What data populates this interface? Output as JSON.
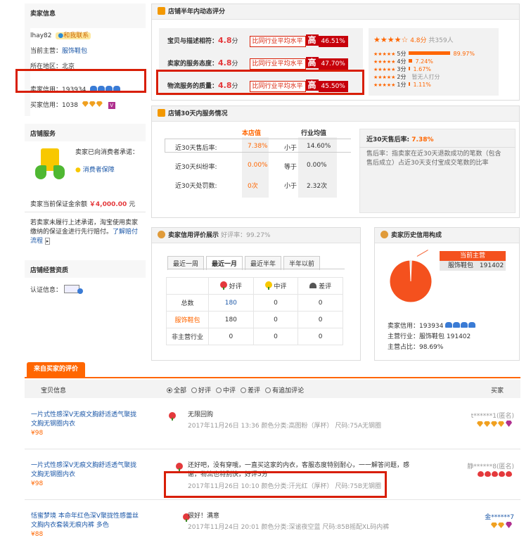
{
  "seller_info": {
    "title": "卖家信息",
    "name": "lhay82",
    "contact": "和我联系",
    "main_biz_label": "当前主营：",
    "main_biz": "服饰鞋包",
    "region_label": "所在地区：",
    "region": "北京",
    "seller_credit_label": "卖家信用：",
    "seller_credit": "193934",
    "buyer_credit_label": "买家信用：",
    "buyer_credit": "1038"
  },
  "shop_service": {
    "title": "店铺服务",
    "promise_text": "卖家已向消费者承诺：",
    "guarantee": "消费者保障",
    "deposit_label": "卖家当前保证金余额",
    "deposit": "￥4,000.00",
    "deposit_unit": "元",
    "note": "若卖家未履行上述承诺，淘宝使用卖家缴纳的保证金进行先行赔付。",
    "note_link": "了解赔付流程"
  },
  "shop_qual": {
    "title": "店铺经营资质",
    "cert_label": "认证信息："
  },
  "dsr": {
    "title": "店铺半年内动态评分",
    "rows": [
      {
        "label": "宝贝与描述相符：",
        "score": "4.8",
        "unit": "分",
        "cmp": "比同行业平均水平",
        "level": "高",
        "pct": "46.51%"
      },
      {
        "label": "卖家的服务态度：",
        "score": "4.8",
        "unit": "分",
        "cmp": "比同行业平均水平",
        "level": "高",
        "pct": "47.70%"
      },
      {
        "label": "物流服务的质量：",
        "score": "4.8",
        "unit": "分",
        "cmp": "比同行业平均水平",
        "level": "高",
        "pct": "45.50%"
      }
    ],
    "summary_score": "4.8分",
    "summary_count": "共359人",
    "dist": [
      {
        "label": "5分",
        "pct": "89.97%",
        "frac": 0.8997
      },
      {
        "label": "4分",
        "pct": "7.24%",
        "frac": 0.0724
      },
      {
        "label": "3分",
        "pct": "1.67%",
        "frac": 0.0167
      },
      {
        "label": "2分",
        "pct": "暂无人打分",
        "frac": 0
      },
      {
        "label": "1分",
        "pct": "1.11%",
        "frac": 0.0111
      }
    ]
  },
  "service30": {
    "title": "店铺30天内服务情况",
    "col_shop": "本店值",
    "col_ind": "行业均值",
    "rows": [
      {
        "label": "近30天售后率:",
        "shop": "7.38%",
        "cmp": "小于",
        "ind": "14.60%"
      },
      {
        "label": "近30天纠纷率:",
        "shop": "0.00%",
        "cmp": "等于",
        "ind": "0.00%"
      },
      {
        "label": "近30天处罚数:",
        "shop": "0次",
        "cmp": "小于",
        "ind": "2.32次"
      }
    ],
    "side_title": "近30天售后率:",
    "side_value": "7.38%",
    "side_desc": "售后率：指卖家在近30天退款成功的笔数（包含售后成立）占近30天支付宝成交笔数的比率"
  },
  "rating": {
    "title": "卖家信用评价展示",
    "good_rate": "好评率：99.27%",
    "tabs": [
      "最近一周",
      "最近一月",
      "最近半年",
      "半年以前"
    ],
    "cols": [
      "好评",
      "中评",
      "差评"
    ],
    "rows": [
      {
        "label": "总数",
        "good": "180",
        "mid": "0",
        "bad": "0"
      },
      {
        "label": "服饰鞋包",
        "good": "180",
        "mid": "0",
        "bad": "0"
      },
      {
        "label": "非主营行业",
        "good": "0",
        "mid": "0",
        "bad": "0"
      }
    ]
  },
  "history": {
    "title": "卖家历史信用构成",
    "main_tag": "当前主营",
    "legend_cat": "服饰鞋包",
    "legend_val": "191402",
    "seller_credit_label": "卖家信用：",
    "seller_credit": "193934",
    "main_biz_label": "主营行业：",
    "main_biz": "服饰鞋包",
    "main_biz_val": "191402",
    "share_label": "主营占比：",
    "share": "98.69%",
    "pie_frac": 0.9869
  },
  "reviews": {
    "tab": "来自买家的评价",
    "col_item": "宝贝信息",
    "filters": [
      "全部",
      "好评",
      "中评",
      "差评",
      "有追加评论"
    ],
    "col_buyer": "买家",
    "items": [
      {
        "title": "一片式性感深V无痕文胸舒适透气聚拢文胸无钢圈内衣",
        "price": "¥98",
        "comment": "无限回购",
        "meta": "2017年11月26日 13:36 颜色分类:高图粉（厚杯） 尺码:75A无钢圈",
        "buyer": "t******1(匿名)",
        "buyer_badge": "diamond4"
      },
      {
        "title": "一片式性感深V无痕文胸舒适透气聚拢文胸无钢圈内衣",
        "price": "¥98",
        "comment": "还好吧，没有穿哦，一直买这家的内衣，客服态度特别耐心，一一解答问题，感谢，物流也特别快，好评5分",
        "meta": "2017年11月26日 10:10 颜色分类:汗光红（厚杯） 尺码:75B无钢圈",
        "buyer": "静******8(匿名)",
        "buyer_badge": "heart5"
      },
      {
        "title": "恬蜜梦境 本命年红色深V聚拢性感蕾丝文胸内衣套装无痕内裤 多色",
        "price": "¥88",
        "comment": "很好！满意",
        "meta": "2017年11月24日 20:01 颜色分类:深谧夜空蓝 尺码:85B摇配XL码内裤",
        "buyer": "金******7",
        "buyer_badge": "diamond2"
      }
    ]
  },
  "colors": {
    "accent": "#f60",
    "brand_red": "#e4393c",
    "high_red": "#c7000b",
    "annotation": "#d81e06",
    "link": "#1e59a8"
  }
}
